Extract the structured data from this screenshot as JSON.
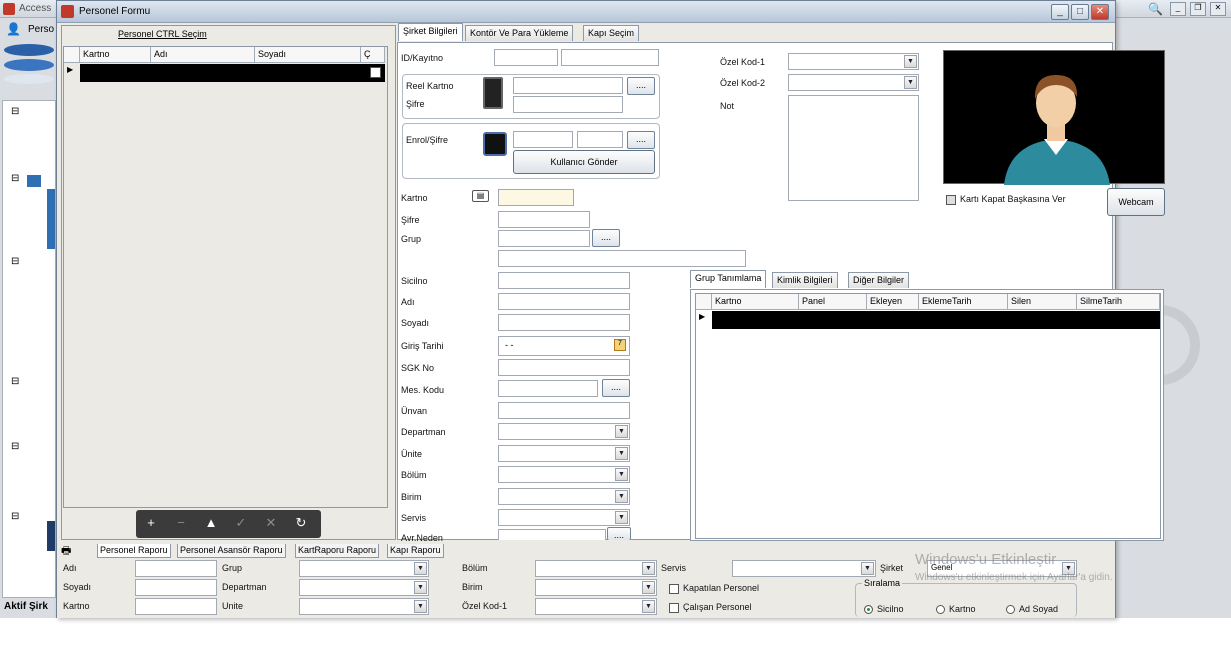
{
  "background_app": {
    "title": "Access",
    "left_label": "Perso",
    "status_text": "Aktif Şirk"
  },
  "window": {
    "title": "Personel Formu",
    "controls": {
      "minimize": "_",
      "maximize": "□",
      "close": "✕"
    }
  },
  "left_panel": {
    "title": "Personel CTRL Seçim",
    "columns": [
      "Kartno",
      "Adı",
      "Soyadı",
      "Ç"
    ],
    "nav_buttons": [
      "+",
      "−",
      "▲",
      "✓",
      "✕",
      "↻"
    ]
  },
  "top_tabs": [
    "Şirket Bilgileri",
    "Kontör Ve Para Yükleme",
    "Kapı Seçim"
  ],
  "form": {
    "id_kayitno": "ID/Kayıtno",
    "reel_kartno": "Reel Kartno",
    "sifre": "Şifre",
    "enrol_sifre": "Enrol/Şifre",
    "kullanici_gonder": "Kullanıcı Gönder",
    "ozel_kod1": "Özel Kod-1",
    "ozel_kod2": "Özel Kod-2",
    "not": "Not",
    "kartno": "Kartno",
    "grup": "Grup",
    "sicilno": "Sicilno",
    "adi": "Adı",
    "soyadi": "Soyadı",
    "giris_tarihi": "Giriş Tarihi",
    "giris_tarihi_value": "- -",
    "sgk_no": "SGK No",
    "mes_kodu": "Mes. Kodu",
    "unvan": "Ünvan",
    "departman": "Departman",
    "unite": "Ünite",
    "bolum": "Bölüm",
    "birim": "Birim",
    "servis": "Servis",
    "ayr_neden": "Ayr.Neden",
    "ellipsis": "....",
    "karti_kapat": "Kartı Kapat Başkasına Ver",
    "webcam": "Webcam"
  },
  "sub_tabs": [
    "Grup Tanımlama",
    "Kimlik Bilgileri",
    "Diğer Bilgiler"
  ],
  "sub_grid_columns": [
    "Kartno",
    "Panel",
    "Ekleyen",
    "EklemeTarih",
    "Silen",
    "SilmeTarih"
  ],
  "bottom_tabs": [
    "Personel Raporu",
    "Personel Asansör Raporu",
    "KartRaporu Raporu",
    "Kapı Raporu"
  ],
  "filters": {
    "adi": "Adı",
    "soyadi": "Soyadı",
    "kartno": "Kartno",
    "grup": "Grup",
    "departman": "Departman",
    "unite": "Unite",
    "bolum": "Bölüm",
    "birim": "Birim",
    "ozel_kod1": "Özel Kod-1",
    "servis": "Servis",
    "kapatilan": "Kapatılan Personel",
    "calisan": "Çalışan Personel",
    "sirket": "Şirket",
    "sirket_value": "Genel",
    "siralama": "Sıralama",
    "sort_options": [
      "Sicilno",
      "Kartno",
      "Ad Soyad"
    ]
  },
  "watermark": {
    "line1": "Windows'u Etkinleştir",
    "line2": "Windows'u etkinleştirmek için Ayarlar'a gidin."
  },
  "colors": {
    "accent": "#2f6fb3",
    "title_bg": "#c9d5e3"
  }
}
